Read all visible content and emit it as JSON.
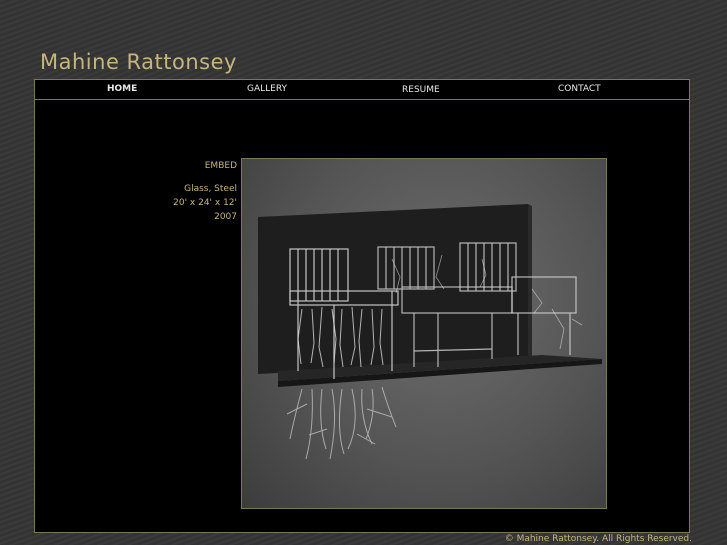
{
  "site": {
    "title": "Mahine Rattonsey"
  },
  "nav": {
    "home": "HOME",
    "gallery": "GALLERY",
    "resume": "RESUME",
    "contact": "CONTACT"
  },
  "artwork": {
    "title": "EMBED",
    "medium": "Glass, Steel",
    "dimensions": "20' x 24' x 12'",
    "year": "2007"
  },
  "footer": {
    "copyright": "© Mahine Rattonsey. All Rights Reserved."
  },
  "colors": {
    "accent": "#c7b57e",
    "border": "#7e7458",
    "background": "#353535",
    "frame": "#000000"
  }
}
